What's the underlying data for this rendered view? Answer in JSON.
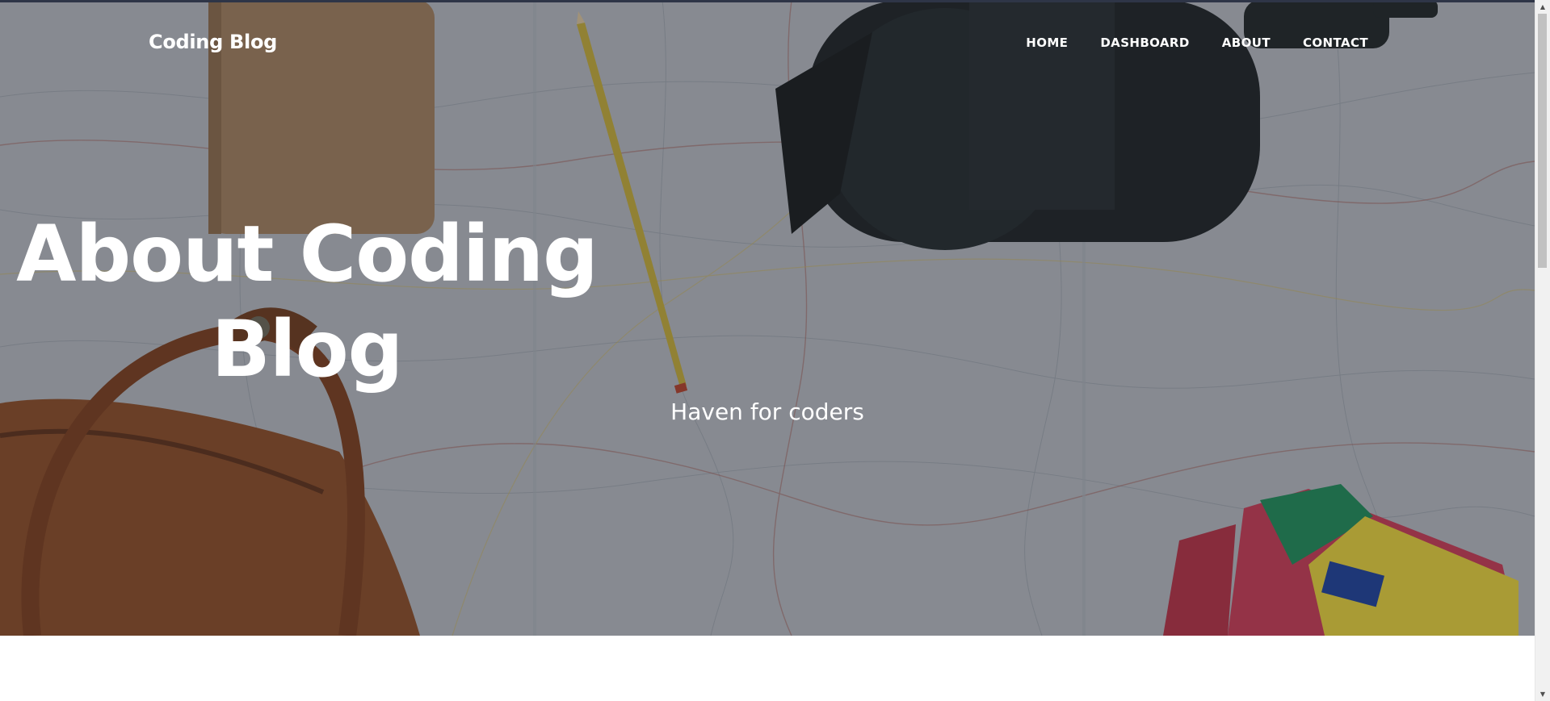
{
  "nav": {
    "brand": "Coding Blog",
    "links": [
      {
        "label": "HOME"
      },
      {
        "label": "DASHBOARD"
      },
      {
        "label": "ABOUT"
      },
      {
        "label": "CONTACT"
      }
    ]
  },
  "hero": {
    "title": "About Coding Blog",
    "subtitle": "Haven for coders",
    "background_image": "map-with-notebook-pencil-camera-bag-background",
    "overlay_color": "#212529"
  },
  "scrollbar": {
    "up_icon": "triangle-up-icon",
    "down_icon": "triangle-down-icon"
  }
}
